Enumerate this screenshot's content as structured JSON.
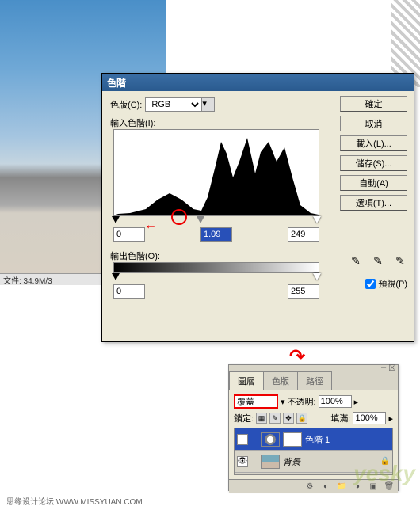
{
  "dialog": {
    "title": "色階",
    "channel_label": "色版(C):",
    "channel_value": "RGB",
    "input_levels_label": "輸入色階(I):",
    "output_levels_label": "輸出色階(O):",
    "input_black": "0",
    "input_gamma": "1.09",
    "input_white": "249",
    "output_black": "0",
    "output_white": "255",
    "buttons": {
      "ok": "確定",
      "cancel": "取消",
      "load": "載入(L)...",
      "save": "儲存(S)...",
      "auto": "自動(A)",
      "options": "選項(T)..."
    },
    "preview_label": "預視(P)"
  },
  "status": {
    "file_info": "文件: 34.9M/3"
  },
  "panel": {
    "tabs": {
      "layers": "圖層",
      "channels": "色版",
      "paths": "路徑"
    },
    "blend_mode": "覆蓋",
    "opacity_label": "不透明:",
    "opacity_value": "100%",
    "lock_label": "鎖定:",
    "fill_label": "填滿:",
    "fill_value": "100%",
    "layers_list": [
      {
        "name": "色階 1",
        "selected": true
      },
      {
        "name": "背景",
        "selected": false
      }
    ]
  },
  "watermark": "yesky",
  "footer": "思缘设计论坛  WWW.MISSYUAN.COM"
}
